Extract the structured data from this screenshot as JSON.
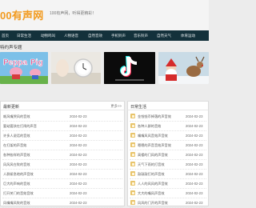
{
  "header": {
    "logo_text": "00有声网",
    "slogan": "100有声网，听得更精彩！"
  },
  "nav": {
    "items": [
      "首页",
      "日常生活",
      "动物鸣叫",
      "人物语音",
      "自然音效",
      "手机铃声",
      "音乐铃声",
      "自然天气",
      "体育运动"
    ]
  },
  "featured": {
    "title": "特约声专题",
    "colors": {
      "pig": "#7cc0e8",
      "clock": "#e9e6df",
      "tiktok": "#0b0b0b",
      "xmas": "#c9dbe6"
    }
  },
  "left_panel": {
    "title": "最新更新",
    "more": "更多>>",
    "rows": [
      {
        "title": "耗风嘴哭风的音效",
        "date": "2024-02-23"
      },
      {
        "title": "婴幼婴孩在打闹的声音",
        "date": "2024-02-23"
      },
      {
        "title": "许多人说话的音效",
        "date": "2024-02-23"
      },
      {
        "title": "在打架的声音效",
        "date": "2024-02-23"
      },
      {
        "title": "各种各样的声音效",
        "date": "2024-02-23"
      },
      {
        "title": "风风风在吹的音效",
        "date": "2024-02-23"
      },
      {
        "title": "人群紧急地的声音效",
        "date": "2024-02-23"
      },
      {
        "title": "巨大的声响的音效",
        "date": "2024-02-23"
      },
      {
        "title": "打开关门的音效音效",
        "date": "2024-02-23"
      },
      {
        "title": "风嘴嘴风吹的音效",
        "date": "2024-02-23"
      }
    ]
  },
  "right_panel": {
    "title": "日常生活",
    "rows": [
      {
        "title": "金钱钱币掉落的声音效",
        "date": "2024-02-23"
      },
      {
        "title": "各种人群的音效",
        "date": "2024-02-23"
      },
      {
        "title": "嘴嘴风风音效声音效",
        "date": "2024-02-23"
      },
      {
        "title": "嗯嗯的声音音效声音效",
        "date": "2024-02-23"
      },
      {
        "title": "高楼的门风的声音效",
        "date": "2024-02-23"
      },
      {
        "title": "天气下雨的打音效",
        "date": "2024-02-23"
      },
      {
        "title": "敲敲敲打的声音效",
        "date": "2024-02-23"
      },
      {
        "title": "人人的风风的声音效",
        "date": "2024-02-23"
      },
      {
        "title": "大大的嘴风声音效",
        "date": "2024-02-23"
      },
      {
        "title": "风风的门开的声音效",
        "date": "2024-02-23"
      }
    ]
  }
}
